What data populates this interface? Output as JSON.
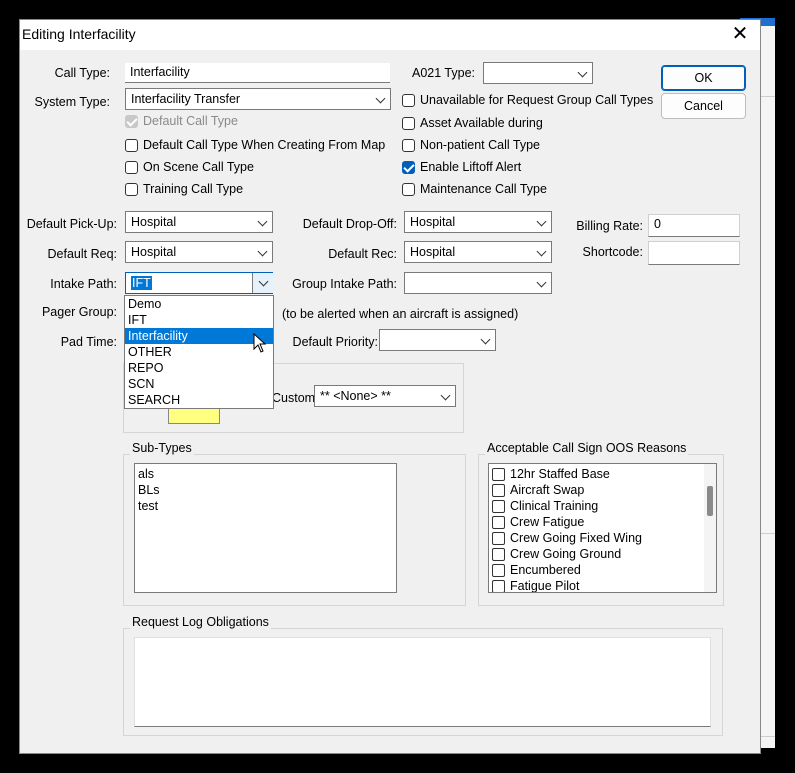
{
  "window": {
    "title": "Editing Interfacility",
    "close_glyph": "✕"
  },
  "buttons": {
    "ok": "OK",
    "cancel": "Cancel"
  },
  "labels": {
    "call_type": "Call Type:",
    "system_type": "System Type:",
    "a021_type": "A021 Type:",
    "default_pickup": "Default Pick-Up:",
    "default_dropoff": "Default Drop-Off:",
    "billing_rate": "Billing Rate:",
    "default_req": "Default Req:",
    "default_rec": "Default Rec:",
    "shortcode": "Shortcode:",
    "intake_path": "Intake Path:",
    "group_intake_path": "Group Intake Path:",
    "pager_group": "Pager Group:",
    "pager_note": "(to be alerted when an aircraft is assigned)",
    "pad_time": "Pad Time:",
    "default_priority": "Default Priority:",
    "custom": "Custom"
  },
  "fields": {
    "call_type": "Interfacility",
    "system_type": "Interfacility Transfer",
    "a021_type": "",
    "default_pickup": "Hospital",
    "default_dropoff": "Hospital",
    "billing_rate": "0",
    "default_req": "Hospital",
    "default_rec": "Hospital",
    "shortcode": "",
    "intake_path": "IFT",
    "group_intake_path": "",
    "default_priority": "",
    "custom": "** <None> **"
  },
  "checkboxes": {
    "default_call_type": {
      "label": "Default Call Type",
      "checked": true,
      "disabled": true
    },
    "default_from_map": {
      "label": "Default Call Type When Creating From Map",
      "checked": false
    },
    "on_scene": {
      "label": "On Scene Call Type",
      "checked": false
    },
    "training": {
      "label": "Training Call Type",
      "checked": false
    },
    "unavailable_request_group": {
      "label": "Unavailable for Request Group Call Types",
      "checked": false
    },
    "asset_available": {
      "label": "Asset Available during",
      "checked": false
    },
    "non_patient": {
      "label": "Non-patient Call Type",
      "checked": false
    },
    "liftoff_alert": {
      "label": "Enable Liftoff Alert",
      "checked": true
    },
    "maintenance": {
      "label": "Maintenance Call Type",
      "checked": false
    }
  },
  "intake_dropdown": {
    "options": [
      "Demo",
      "IFT",
      "Interfacility",
      "OTHER",
      "REPO",
      "SCN",
      "SEARCH"
    ],
    "highlighted": "Interfacility"
  },
  "color_swatch": "#ffff80",
  "sub_types": {
    "title": "Sub-Types",
    "items": [
      "als",
      "BLs",
      "test"
    ]
  },
  "oos_reasons": {
    "title": "Acceptable Call Sign OOS Reasons",
    "items": [
      "12hr Staffed Base",
      "Aircraft Swap",
      "Clinical Training",
      "Crew Fatigue",
      "Crew Going Fixed Wing",
      "Crew Going Ground",
      "Encumbered",
      "Fatigue Pilot"
    ]
  },
  "request_log": {
    "title": "Request Log Obligations"
  },
  "colors": {
    "accent": "#005fb8",
    "highlight": "#0078d7",
    "dialog_bg": "#f0f0f0"
  }
}
